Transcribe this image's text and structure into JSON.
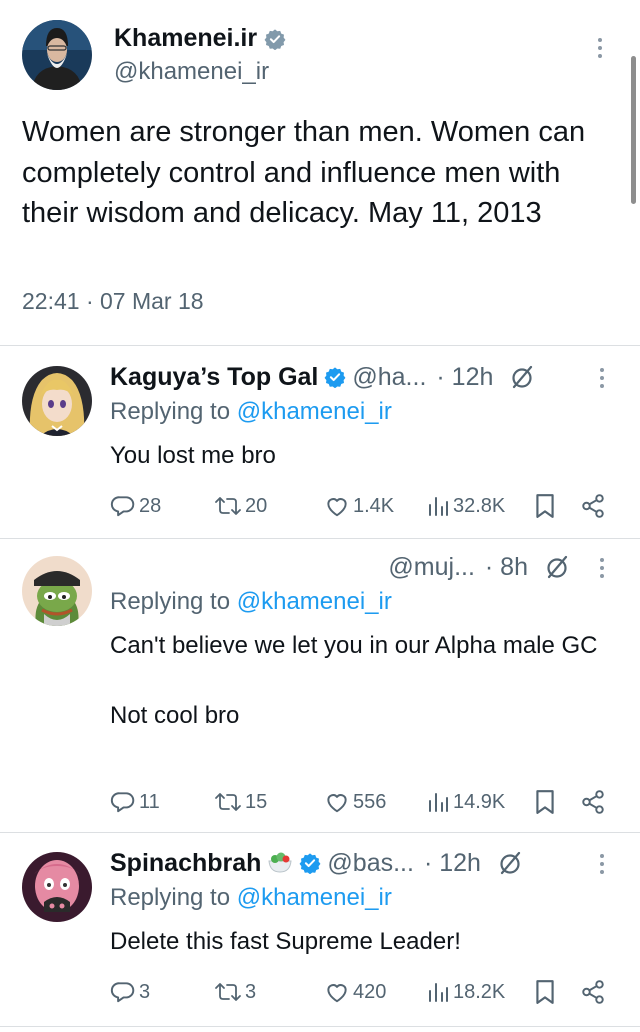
{
  "main_tweet": {
    "display_name": "Khamenei.ir",
    "handle": "@khamenei_ir",
    "text": "Women are stronger than men. Women can completely control and influence men with their wisdom and delicacy. May 11, 2013",
    "timestamp": "22:41 · 07 Mar 18"
  },
  "replies": [
    {
      "display_name": "Kaguya’s Top Gal",
      "handle": "@ha...",
      "time": "· 12h",
      "replying_prefix": "Replying to ",
      "replying_to": "@khamenei_ir",
      "text": "You lost me bro",
      "stats": {
        "replies": "28",
        "reposts": "20",
        "likes": "1.4K",
        "views": "32.8K"
      }
    },
    {
      "display_name": "",
      "handle": "@muj...",
      "time": "· 8h",
      "replying_prefix": "Replying to ",
      "replying_to": "@khamenei_ir",
      "text": "Can't believe we let you in our Alpha male GC\n\nNot cool bro",
      "stats": {
        "replies": "11",
        "reposts": "15",
        "likes": "556",
        "views": "14.9K"
      }
    },
    {
      "display_name": "Spinachbrah",
      "handle": "@bas...",
      "time": "· 12h",
      "replying_prefix": "Replying to ",
      "replying_to": "@khamenei_ir",
      "text": "Delete this fast Supreme Leader!",
      "stats": {
        "replies": "3",
        "reposts": "3",
        "likes": "420",
        "views": "18.2K"
      }
    }
  ],
  "colors": {
    "verified": "#1d9bf0",
    "mention": "#1d9bf0",
    "muted": "#536471",
    "gray_badge": "#829aab"
  },
  "icons": [
    "verified-badge-icon",
    "more-icon",
    "grok-icon",
    "reply-icon",
    "repost-icon",
    "like-icon",
    "views-icon",
    "bookmark-icon",
    "share-icon",
    "salad-emoji-icon"
  ]
}
